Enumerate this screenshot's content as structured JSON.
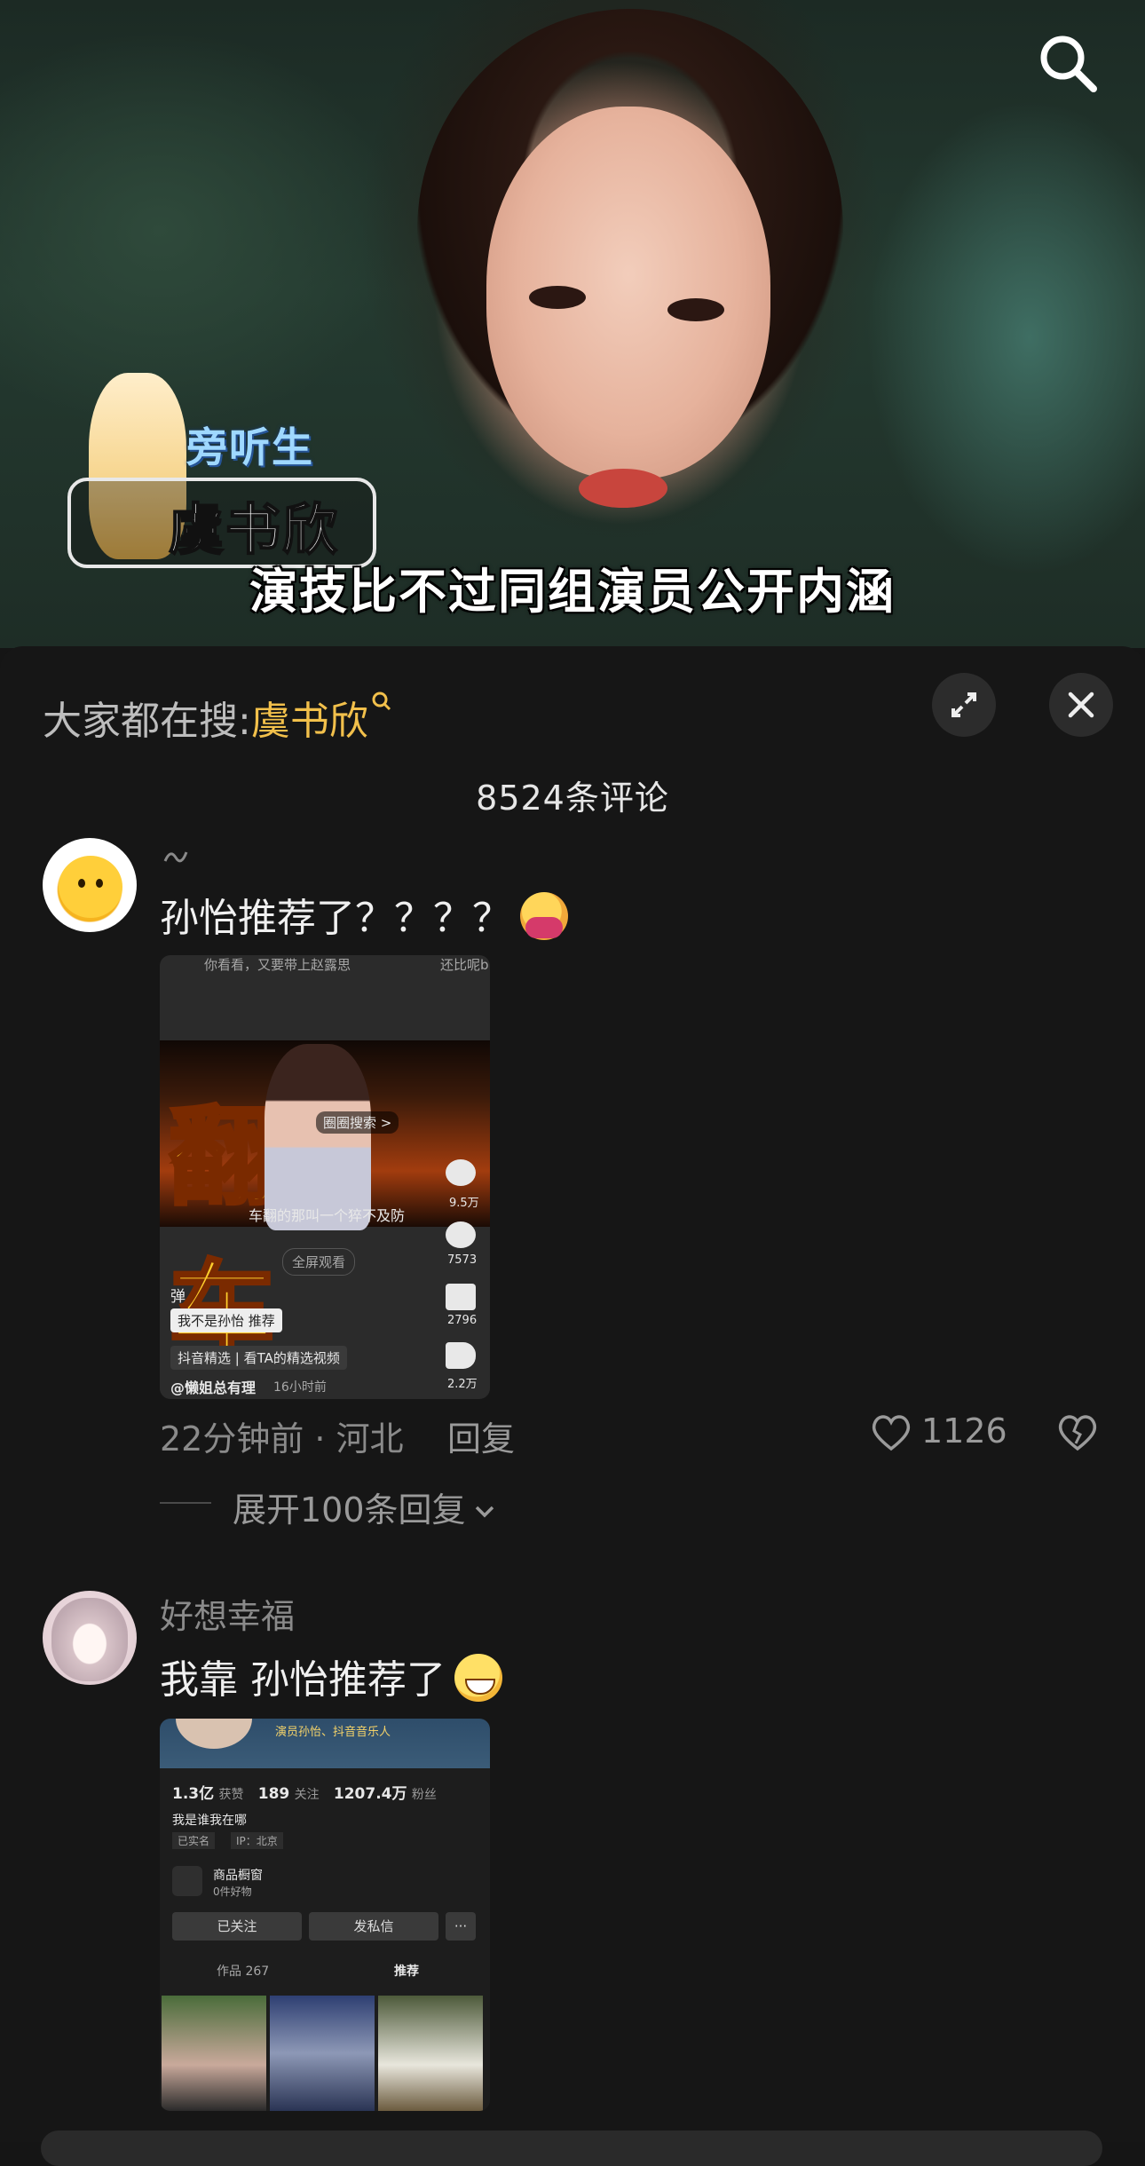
{
  "video": {
    "subtitle": "演技比不过同组演员公开内涵",
    "show_badge_top": "旁听生",
    "show_badge_name": "虞书欣"
  },
  "sheet": {
    "trend_label": "大家都在搜:",
    "trend_term": "虞书欣",
    "comment_count": "8524条评论"
  },
  "comments": [
    {
      "username": "",
      "text": "孙怡推荐了？？？？",
      "emoji": "hugging-face-emoji",
      "image": {
        "top_caption_left": "你看看，又要带上赵露思",
        "top_caption_right": "还比呢b",
        "big_text": "翻车",
        "circle_search": "圈圈搜索 >",
        "caption": "车翻的那叫一个猝不及防",
        "fullscreen": "全屏观看",
        "likes": "9.5万",
        "comments": "7573",
        "favorites": "2796",
        "shares": "2.2万",
        "handle_small": "弹",
        "recommend_tag": "我不是孙怡 推荐",
        "selection": "抖音精选 | 看TA的精选视频",
        "author": "@懒姐总有理",
        "time": "16小时前"
      },
      "time_location": "22分钟前 · 河北",
      "reply_label": "回复",
      "likes": "1126",
      "expand_label": "展开100条回复"
    },
    {
      "username": "好想幸福",
      "text": "我靠 孙怡推荐了",
      "emoji": "grinning-face-emoji",
      "image": {
        "verified": "演员孙怡、抖音音乐人",
        "likes_count": "1.3亿",
        "likes_label": "获赞",
        "following_count": "189",
        "following_label": "关注",
        "fans_count": "1207.4万",
        "fans_label": "粉丝",
        "bio": "我是谁我在哪",
        "realname_tag": "已实名",
        "ip_tag": "IP：北京",
        "shop_title": "商品橱窗",
        "shop_sub": "0件好物",
        "followed_button": "已关注",
        "message_button": "发私信",
        "more_button": "···",
        "tab_works": "作品 267",
        "tab_recommend": "推荐"
      }
    }
  ]
}
